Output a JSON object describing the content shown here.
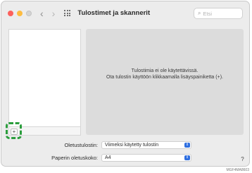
{
  "window": {
    "title": "Tulostimet ja skannerit",
    "search_placeholder": "Etsi"
  },
  "icons": {
    "back": "‹",
    "forward": "›",
    "search": "⌕",
    "add": "+",
    "stepper": "⇕",
    "help": "?"
  },
  "detail": {
    "empty_line1": "Tulostimia ei ole käytettävissä.",
    "empty_line2": "Ota tulostin käyttöön klikkaamalla lisäyspainiketta (+)."
  },
  "settings": {
    "default_printer_label": "Oletustulostin:",
    "default_printer_value": "Viimeksi käytetty tulostin",
    "paper_size_label": "Paperin oletuskoko:",
    "paper_size_value": "A4"
  },
  "footer_code": "MGF4MA8603",
  "colors": {
    "highlight": "#2a9d3c",
    "accent": "#2f6fe0"
  }
}
